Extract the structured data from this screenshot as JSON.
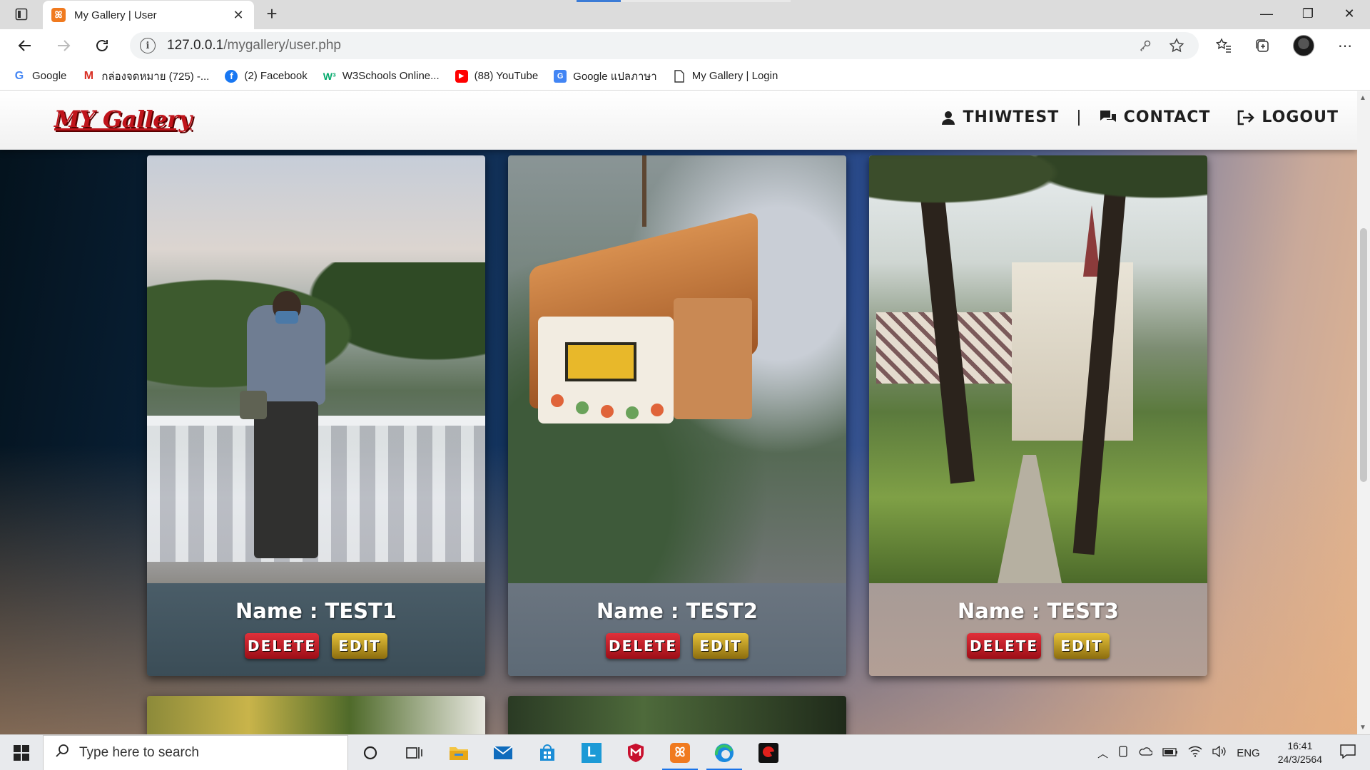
{
  "browser": {
    "tab_title": "My Gallery | User",
    "url_host": "127.0.0.1",
    "url_path": "/mygallery/user.php",
    "bookmarks": [
      {
        "label": "Google",
        "icon": "google-icon"
      },
      {
        "label": "กล่องจดหมาย (725) -...",
        "icon": "gmail-icon"
      },
      {
        "label": "(2) Facebook",
        "icon": "facebook-icon"
      },
      {
        "label": "W3Schools Online...",
        "icon": "w3schools-icon"
      },
      {
        "label": "(88) YouTube",
        "icon": "youtube-icon"
      },
      {
        "label": "Google แปลภาษา",
        "icon": "google-translate-icon"
      },
      {
        "label": "My Gallery | Login",
        "icon": "page-icon"
      }
    ]
  },
  "site": {
    "logo": "MY Gallery",
    "nav": {
      "user": "THIWTEST",
      "separator": "|",
      "contact": "CONTACT",
      "logout": "LOGOUT"
    }
  },
  "gallery": {
    "cards": [
      {
        "name": "Name : TEST1",
        "delete_label": "DELETE",
        "edit_label": "EDIT",
        "photo": "man-on-bridge-photo"
      },
      {
        "name": "Name : TEST2",
        "delete_label": "DELETE",
        "edit_label": "EDIT",
        "photo": "ceramic-house-ornament-photo"
      },
      {
        "name": "Name : TEST3",
        "delete_label": "DELETE",
        "edit_label": "EDIT",
        "photo": "palace-garden-photo"
      }
    ]
  },
  "taskbar": {
    "search_placeholder": "Type here to search",
    "language": "ENG",
    "time": "16:41",
    "date": "24/3/2564"
  },
  "colors": {
    "logo_red": "#c0141b",
    "delete_red": "#c41e28",
    "edit_gold": "#c9a32a",
    "header_bg": "#ffffff"
  }
}
